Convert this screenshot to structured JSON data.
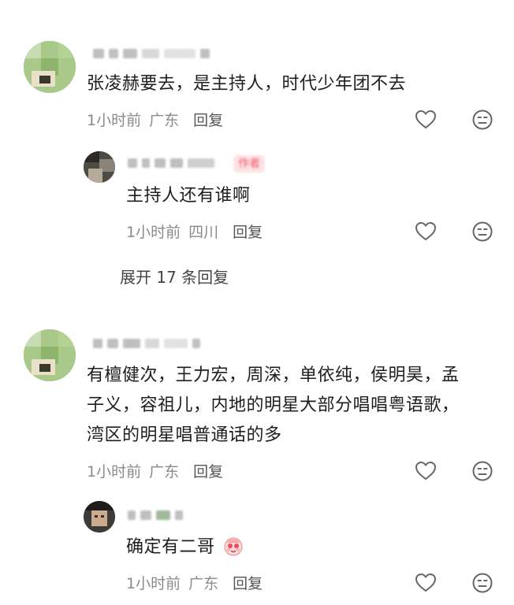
{
  "comments": [
    {
      "text": "张凌赫要去，是主持人，时代少年团不去",
      "time": "1小时前",
      "location": "广东",
      "reply_label": "回复",
      "replies": [
        {
          "text": "主持人还有谁啊",
          "time": "1小时前",
          "location": "四川",
          "reply_label": "回复",
          "tag": "作者"
        }
      ],
      "expand_label": "展开 17 条回复"
    },
    {
      "text_lines": [
        "有檀健次，王力宏，周深，单依纯，侯明昊，孟",
        "子义，容祖儿，内地的明星大部分唱唱粤语歌，",
        "湾区的明星唱普通话的多"
      ],
      "time": "1小时前",
      "location": "广东",
      "reply_label": "回复",
      "replies": [
        {
          "text": "确定有二哥",
          "time": "1小时前",
          "location": "广东",
          "reply_label": "回复"
        }
      ]
    }
  ],
  "icons": {
    "like": "heart-outline-icon",
    "dislike": "neutral-face-icon",
    "emoji": "blushing-face-emoji"
  },
  "colors": {
    "text": "#1e1e1e",
    "meta": "#8a8a8a",
    "tag_bg": "#fde2e4",
    "tag_text": "#f0566a"
  }
}
